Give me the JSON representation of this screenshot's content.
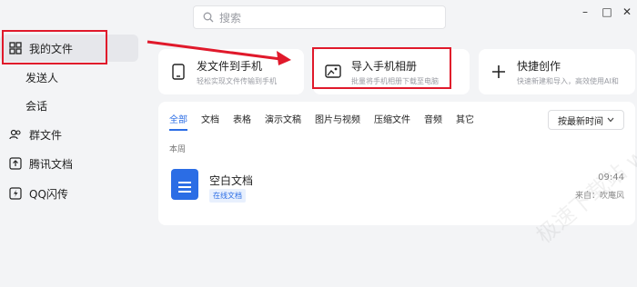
{
  "sidebar": {
    "items": [
      {
        "label": "我的文件"
      },
      {
        "label": "发送人"
      },
      {
        "label": "会话"
      },
      {
        "label": "群文件"
      },
      {
        "label": "腾讯文档"
      },
      {
        "label": "QQ闪传"
      }
    ]
  },
  "search": {
    "placeholder": "搜索"
  },
  "window": {
    "min": "–",
    "max": "□",
    "close": "✕"
  },
  "cards": [
    {
      "title": "发文件到手机",
      "sub": "轻松实现文件传输到手机"
    },
    {
      "title": "导入手机相册",
      "sub": "批量将手机相册下载至电脑"
    },
    {
      "title": "快捷创作",
      "sub": "快速新建和导入，高效使用AI和"
    }
  ],
  "tabs": [
    "全部",
    "文档",
    "表格",
    "演示文稿",
    "图片与视频",
    "压缩文件",
    "音频",
    "其它"
  ],
  "sort": {
    "label": "按最新时间"
  },
  "section": "本周",
  "file": {
    "name": "空白文档",
    "tag": "在线文档",
    "time": "09:44",
    "from": "来自：吹庵风"
  },
  "watermark": "极速下载站 www.mydown.com",
  "colors": {
    "accent": "#2b6de5",
    "highlight": "#e0192b"
  }
}
